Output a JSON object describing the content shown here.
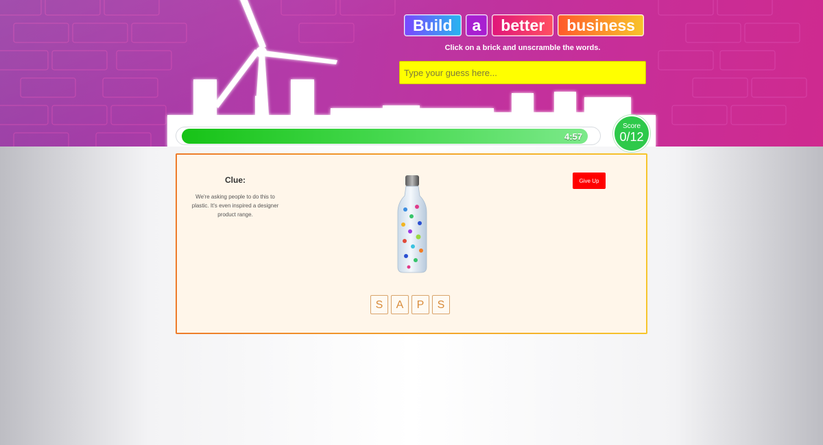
{
  "title": {
    "words": [
      "Build",
      "a",
      "better",
      "business"
    ]
  },
  "instruction": "Click on a brick and unscramble the words.",
  "guess": {
    "placeholder": "Type your guess here...",
    "value": ""
  },
  "timer": {
    "remaining": "4:57",
    "progress_fraction": 0.98
  },
  "score": {
    "label": "Score",
    "value": "0/12"
  },
  "clue": {
    "title": "Clue:",
    "text": "We're asking people to do this to plastic. It's even inspired a designer product range."
  },
  "give_up_label": "Give Up",
  "scrambled_letters": [
    "S",
    "A",
    "P",
    "S"
  ],
  "colors": {
    "input_bg": "#ffff00",
    "give_up": "#ff0000",
    "score": "#2ec94a",
    "progress": "#17c317"
  },
  "icons": [
    "wind-turbine-icon",
    "water-bottle-image"
  ]
}
